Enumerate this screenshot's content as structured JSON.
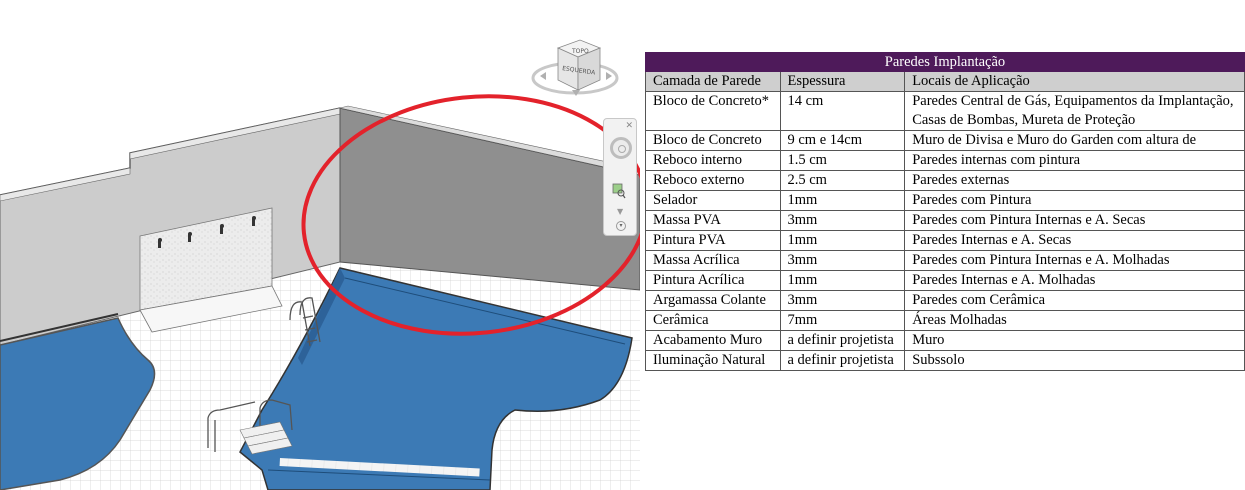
{
  "viewcube": {
    "face_top": "TOPO",
    "face_left": "ESQUERDA"
  },
  "viewport_colors": {
    "wall": "#c8c8c8",
    "wall_dark": "#8f8f8f",
    "water": "#3c7ab5",
    "highlight_ring": "#e3222b",
    "floor_tile": "#ffffff"
  },
  "table": {
    "title": "Paredes Implantação",
    "headers": [
      "Camada de Parede",
      "Espessura",
      "Locais de Aplicação"
    ],
    "rows": [
      {
        "camada": "Bloco de Concreto*",
        "espessura": "14 cm",
        "locais": "Paredes Central de Gás, Equipamentos da Implantação, Casas de Bombas, Mureta de Proteção"
      },
      {
        "camada": "Bloco de Concreto",
        "espessura": "9 cm e 14cm",
        "locais": "Muro de Divisa e Muro do Garden com altura de"
      },
      {
        "camada": "Reboco interno",
        "espessura": "1.5 cm",
        "locais": "Paredes internas com pintura"
      },
      {
        "camada": "Reboco externo",
        "espessura": "2.5 cm",
        "locais": "Paredes externas"
      },
      {
        "camada": "Selador",
        "espessura": "1mm",
        "locais": "Paredes com Pintura"
      },
      {
        "camada": "Massa PVA",
        "espessura": "3mm",
        "locais": "Paredes com Pintura Internas e A. Secas"
      },
      {
        "camada": "Pintura PVA",
        "espessura": "1mm",
        "locais": "Paredes Internas e A. Secas"
      },
      {
        "camada": "Massa Acrílica",
        "espessura": "3mm",
        "locais": "Paredes com Pintura Internas e A. Molhadas"
      },
      {
        "camada": "Pintura Acrílica",
        "espessura": "1mm",
        "locais": "Paredes Internas e A. Molhadas"
      },
      {
        "camada": "Argamassa Colante",
        "espessura": "3mm",
        "locais": "Paredes com Cerâmica"
      },
      {
        "camada": "Cerâmica",
        "espessura": "7mm",
        "locais": "Áreas Molhadas"
      },
      {
        "camada": "Acabamento Muro",
        "espessura": "a definir projetista",
        "locais": "Muro"
      },
      {
        "camada": "Iluminação Natural",
        "espessura": "a definir projetista",
        "locais": "Subssolo"
      }
    ]
  }
}
